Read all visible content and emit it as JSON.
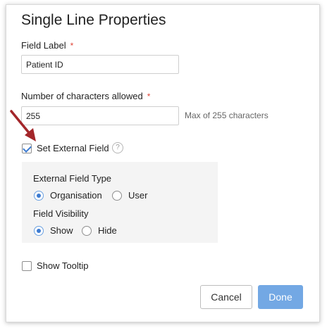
{
  "dialog": {
    "title": "Single Line Properties",
    "field_label": {
      "label": "Field Label",
      "required_marker": "*",
      "value": "Patient ID"
    },
    "chars_allowed": {
      "label": "Number of characters allowed",
      "required_marker": "*",
      "value": "255",
      "hint": "Max of 255 characters"
    },
    "set_external_field": {
      "label": "Set External Field",
      "checked": true,
      "help_icon": "?"
    },
    "external_panel": {
      "type_label": "External Field Type",
      "type_options": [
        "Organisation",
        "User"
      ],
      "type_selected": "Organisation",
      "visibility_label": "Field Visibility",
      "visibility_options": [
        "Show",
        "Hide"
      ],
      "visibility_selected": "Show"
    },
    "show_tooltip": {
      "label": "Show Tooltip",
      "checked": false
    },
    "buttons": {
      "cancel": "Cancel",
      "done": "Done"
    }
  },
  "colors": {
    "accent": "#3d7bd1",
    "done_button": "#73a8e4",
    "required": "#e0473a",
    "annotation_arrow": "#a3262a"
  }
}
